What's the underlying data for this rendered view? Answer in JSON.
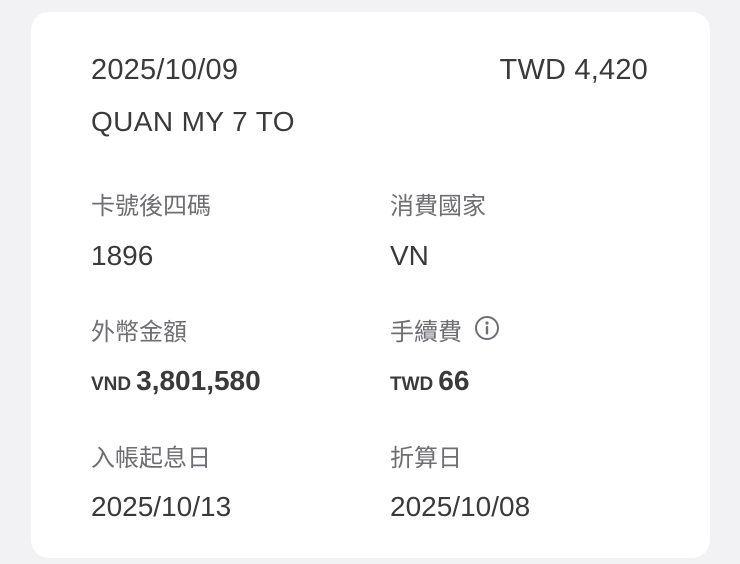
{
  "transaction": {
    "date": "2025/10/09",
    "amount": "TWD 4,420",
    "merchant": "QUAN MY 7 TO"
  },
  "details": {
    "card_last4_label": "卡號後四碼",
    "card_last4_value": "1896",
    "country_label": "消費國家",
    "country_value": "VN",
    "foreign_amount_label": "外幣金額",
    "foreign_amount_currency": "VND",
    "foreign_amount_value": "3,801,580",
    "fee_label": "手續費",
    "fee_icon": "info-icon",
    "fee_currency": "TWD",
    "fee_value": "66",
    "posting_date_label": "入帳起息日",
    "posting_date_value": "2025/10/13",
    "conversion_date_label": "折算日",
    "conversion_date_value": "2025/10/08"
  }
}
